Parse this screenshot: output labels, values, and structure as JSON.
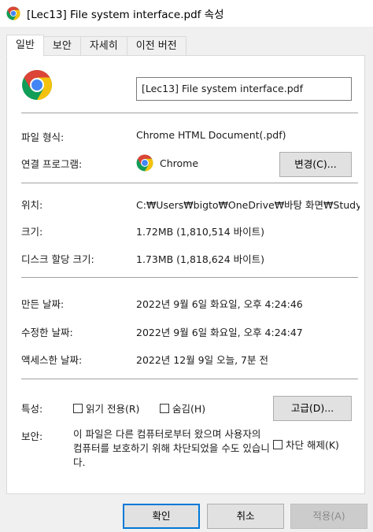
{
  "window": {
    "title": "[Lec13] File system interface.pdf 속성"
  },
  "tabs": [
    {
      "label": "일반"
    },
    {
      "label": "보안"
    },
    {
      "label": "자세히"
    },
    {
      "label": "이전 버전"
    }
  ],
  "general": {
    "file_name": "[Lec13] File system interface.pdf",
    "file_type_label": "파일 형식:",
    "file_type_value": "Chrome HTML Document(.pdf)",
    "opens_with_label": "연결 프로그램:",
    "opens_with_value": "Chrome",
    "change_button": "변경(C)...",
    "location_label": "위치:",
    "location_value": "C:₩Users₩bigto₩OneDrive₩바탕 화면₩Study₩",
    "size_label": "크기:",
    "size_value": "1.72MB (1,810,514 바이트)",
    "size_on_disk_label": "디스크 할당 크기:",
    "size_on_disk_value": "1.73MB (1,818,624 바이트)",
    "created_label": "만든 날짜:",
    "created_value": "2022년 9월 6일 화요일, 오후 4:24:46",
    "modified_label": "수정한 날짜:",
    "modified_value": "2022년 9월 6일 화요일, 오후 4:24:47",
    "accessed_label": "액세스한 날짜:",
    "accessed_value": "2022년 12월 9일 오늘, 7분 전",
    "attributes_label": "특성:",
    "readonly_label": "읽기 전용(R)",
    "hidden_label": "숨김(H)",
    "advanced_button": "고급(D)...",
    "security_label": "보안:",
    "security_text": "이 파일은 다른 컴퓨터로부터 왔으며 사용자의 컴퓨터를 보호하기 위해 차단되었을 수도 있습니다.",
    "unblock_label": "차단 해제(K)"
  },
  "footer": {
    "ok": "확인",
    "cancel": "취소",
    "apply": "적용(A)"
  },
  "colors": {
    "accent": "#0078d7",
    "chrome_red": "#db4437",
    "chrome_yellow": "#f4c20d",
    "chrome_green": "#0f9d58",
    "chrome_blue": "#4285f4"
  }
}
